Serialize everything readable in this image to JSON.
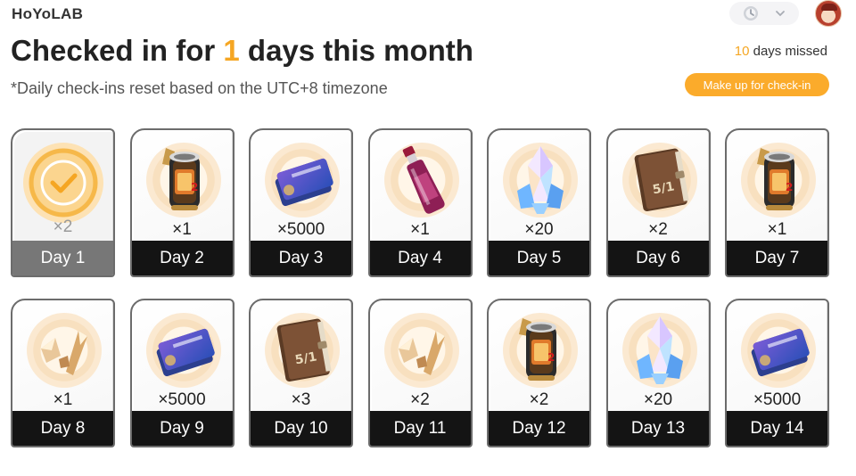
{
  "header": {
    "logo": "HoYoLAB",
    "controls": [
      "clock-icon",
      "chevron-down-icon"
    ],
    "avatar": "user-avatar"
  },
  "checkin": {
    "title_prefix": "Checked in for ",
    "days": "1",
    "title_suffix": " days this month",
    "subtitle": "*Daily check-ins reset based on the UTC+8 timezone",
    "missed_count": "10",
    "missed_suffix": " days missed",
    "makeup_label": "Make up for check-in"
  },
  "rewards": [
    {
      "day": "Day 1",
      "qty": "×2",
      "item": "claimed-check",
      "claimed": true
    },
    {
      "day": "Day 2",
      "qty": "×1",
      "item": "battery-canister-icon",
      "claimed": false
    },
    {
      "day": "Day 3",
      "qty": "×5000",
      "item": "credit-cards-icon",
      "claimed": false
    },
    {
      "day": "Day 4",
      "qty": "×1",
      "item": "potion-bottle-icon",
      "claimed": false
    },
    {
      "day": "Day 5",
      "qty": "×20",
      "item": "crystal-icon",
      "claimed": false
    },
    {
      "day": "Day 6",
      "qty": "×2",
      "item": "book-icon",
      "claimed": false
    },
    {
      "day": "Day 7",
      "qty": "×1",
      "item": "battery-canister-icon",
      "claimed": false
    },
    {
      "day": "Day 8",
      "qty": "×1",
      "item": "ore-fragments-icon",
      "claimed": false
    },
    {
      "day": "Day 9",
      "qty": "×5000",
      "item": "credit-cards-icon",
      "claimed": false
    },
    {
      "day": "Day 10",
      "qty": "×3",
      "item": "book-icon",
      "claimed": false
    },
    {
      "day": "Day 11",
      "qty": "×2",
      "item": "ore-fragments-icon",
      "claimed": false
    },
    {
      "day": "Day 12",
      "qty": "×2",
      "item": "battery-canister-icon",
      "claimed": false
    },
    {
      "day": "Day 13",
      "qty": "×20",
      "item": "crystal-icon",
      "claimed": false
    },
    {
      "day": "Day 14",
      "qty": "×5000",
      "item": "credit-cards-icon",
      "claimed": false
    }
  ],
  "colors": {
    "accent": "#f5a623",
    "button": "#fbab2b",
    "label_bg": "#141414",
    "claimed_label_bg": "#777777"
  }
}
